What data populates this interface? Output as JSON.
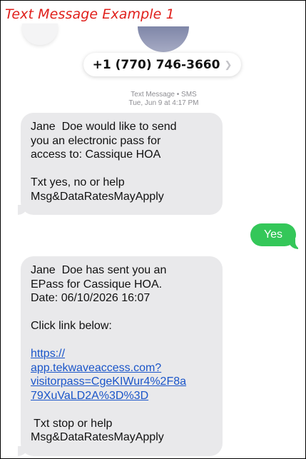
{
  "caption": "Text Message Example 1",
  "header": {
    "phone_number": "+1 (770) 746-3660",
    "chevron_icon": "chevron-right-icon"
  },
  "meta": {
    "service": "Text Message • SMS",
    "date_prefix": "Tue, Jun 9",
    "date_suffix": " at 4:17 PM"
  },
  "messages": {
    "incoming_1": {
      "lines": [
        "Jane  Doe would like to send",
        "you an electronic pass for",
        "access to: Cassique HOA",
        "",
        "Txt yes, no or help",
        "Msg&DataRatesMayApply"
      ]
    },
    "outgoing_1": {
      "text": "Yes"
    },
    "incoming_2": {
      "lines_top": [
        "Jane  Doe has sent you an",
        "EPass for Cassique HOA.",
        "Date: 06/10/2026 16:07",
        "",
        "Click link below:",
        ""
      ],
      "link_lines": [
        "https://",
        "app.tekwaveaccess.com?",
        "visitorpass=CgeKIWur4%2F8a",
        "79XuVaLD2A%3D%3D"
      ],
      "lines_bottom": [
        "",
        " Txt stop or help",
        "Msg&DataRatesMayApply"
      ]
    }
  },
  "colors": {
    "incoming_bubble": "#e9e9eb",
    "outgoing_bubble": "#34c759",
    "link": "#1a55c9",
    "caption": "#e0201c"
  }
}
